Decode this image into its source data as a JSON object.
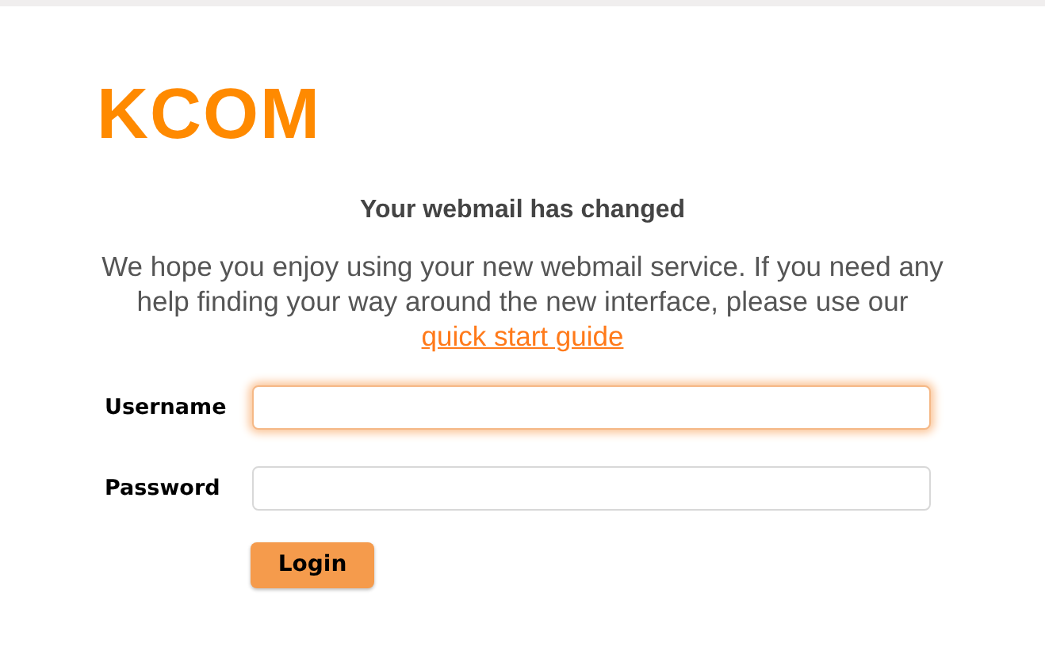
{
  "logo": "KCOM",
  "heading": "Your webmail has changed",
  "intro": {
    "text": "We hope you enjoy using your new webmail service. If you need any help finding your way around the new interface, please use our",
    "link": "quick start guide"
  },
  "fields": [
    {
      "label": "Username",
      "focused": true
    },
    {
      "label": "Password",
      "focused": false
    }
  ],
  "login_button": "Login"
}
